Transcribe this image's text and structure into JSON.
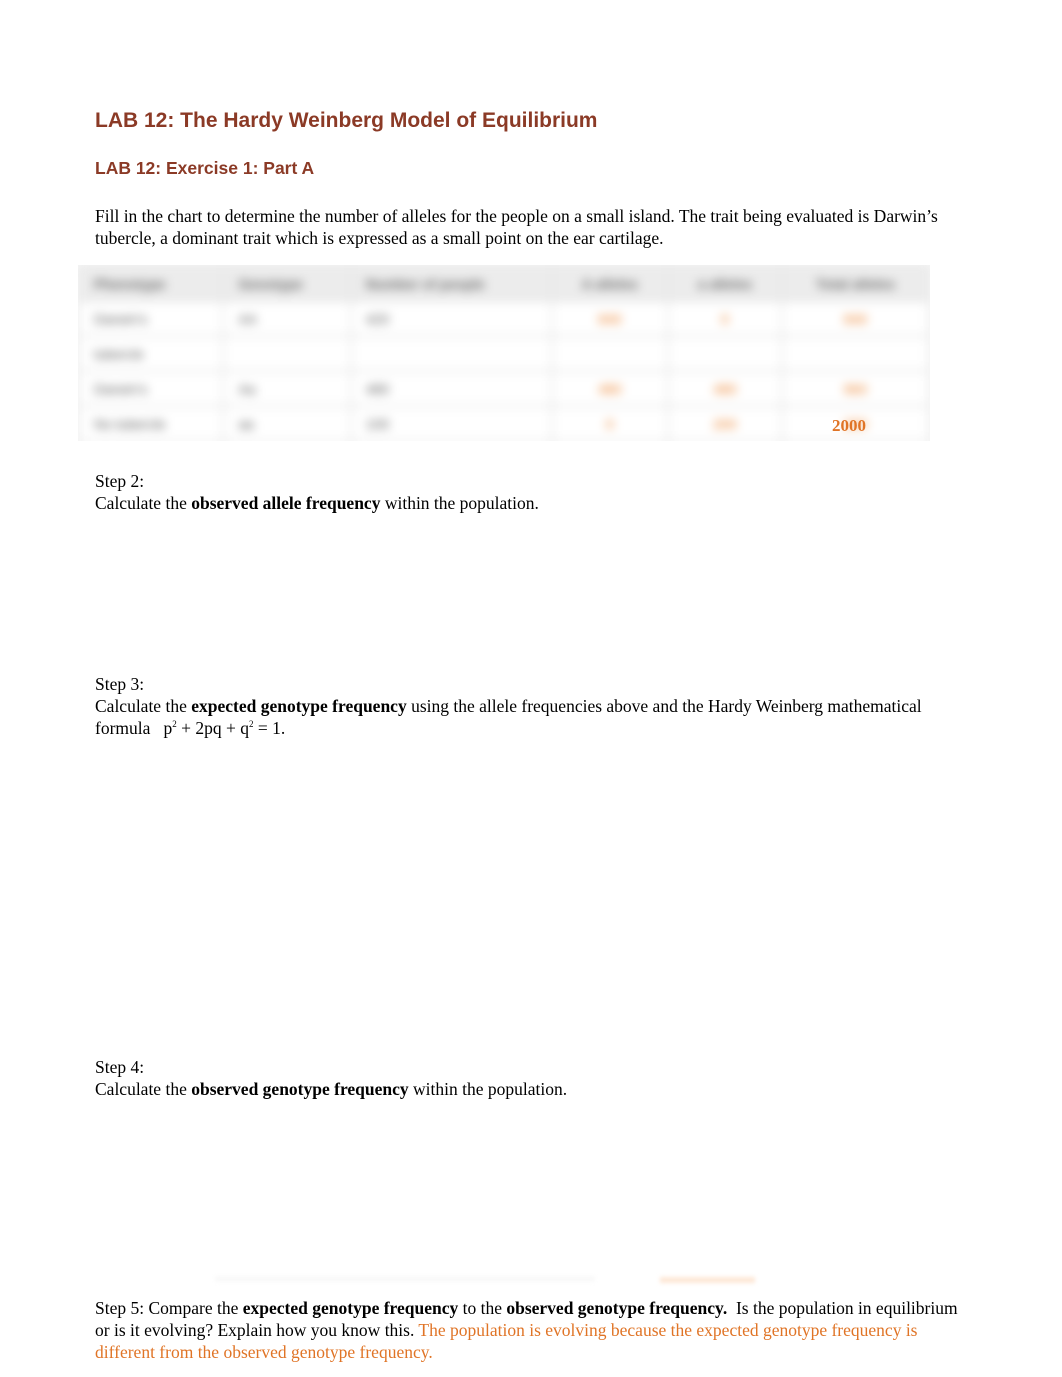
{
  "document": {
    "title": "LAB 12: The Hardy Weinberg Model of Equilibrium",
    "subtitle": "LAB 12: Exercise 1: Part A",
    "intro": "Fill in the chart to determine the number of alleles for the people on a small island. The trait being evaluated is Darwin’s tubercle, a dominant trait which is expressed as a small point on the ear cartilage.",
    "table": {
      "note": "table contents blurred in screenshot",
      "visible_total_alleles": "2000"
    },
    "step2": {
      "label": "Step 2:",
      "pre": "Calculate the ",
      "bold": "observed allele frequency",
      "post": " within the population."
    },
    "step3": {
      "label": "Step 3:",
      "pre": "Calculate the ",
      "bold": "expected genotype frequency",
      "post": " using the allele frequencies above and the Hardy Weinberg mathematical formula",
      "formula_p": "p",
      "formula_mid": " + 2pq + q",
      "formula_end": " = 1.",
      "exp": "2"
    },
    "step4": {
      "label": "Step 4:",
      "pre": "Calculate the ",
      "bold": "observed genotype frequency",
      "post": " within the population."
    },
    "step5": {
      "pre": "Step 5: Compare the ",
      "bold1": "expected genotype frequency",
      "mid": " to the ",
      "bold2": "observed genotype frequency.",
      "post": "  Is the population in equilibrium or is it evolving? Explain how you know this. ",
      "answer": "The population is evolving because the expected genotype frequency is different from the observed genotype frequency."
    }
  }
}
